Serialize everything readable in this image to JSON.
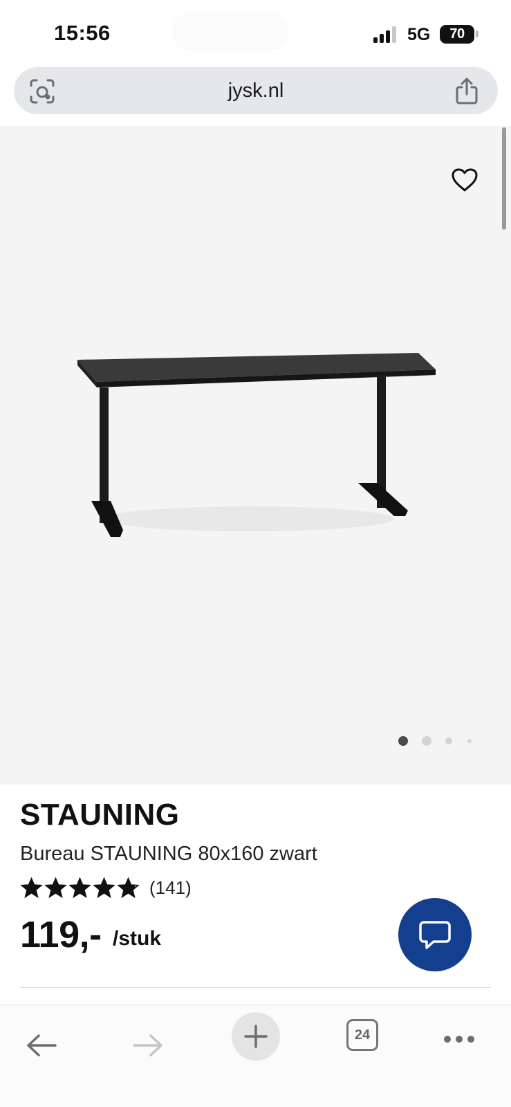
{
  "status_bar": {
    "time": "15:56",
    "network": "5G",
    "battery": "70",
    "signal_bars_active": 3,
    "signal_bars_total": 4
  },
  "browser": {
    "url": "jysk.nl",
    "left_icon": "camera-scan-icon",
    "right_icon": "share-icon"
  },
  "gallery": {
    "favorite_icon": "heart-icon",
    "total_images": 4,
    "active_index": 0,
    "background_color": "#f4f4f4"
  },
  "product": {
    "brand": "STAUNING",
    "title": "Bureau STAUNING 80x160 zwart",
    "rating_value": 4.8,
    "rating_max": 5,
    "review_count": "(141)",
    "price": "119,-",
    "unit": "/stuk"
  },
  "chat": {
    "icon": "chat-bubble-icon",
    "color": "#143f8f"
  },
  "toolbar": {
    "back_icon": "arrow-left-icon",
    "forward_icon": "arrow-right-icon",
    "new_tab_icon": "plus-icon",
    "tab_count": "24",
    "more_icon": "ellipsis-icon"
  }
}
